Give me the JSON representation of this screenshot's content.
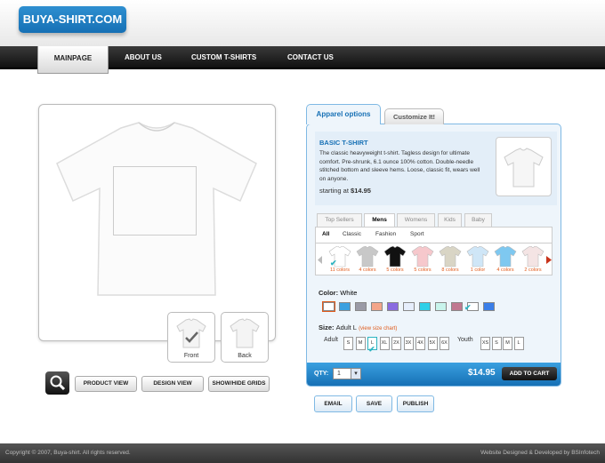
{
  "brand": {
    "logo": "BUYA-SHIRT.COM"
  },
  "nav": {
    "items": [
      "MAINPAGE",
      "ABOUT US",
      "CUSTOM T-SHIRTS",
      "CONTACT US"
    ]
  },
  "preview": {
    "thumbs": [
      "Front",
      "Back"
    ],
    "buttons": [
      "PRODUCT VIEW",
      "DESIGN VIEW",
      "SHOW/HIDE GRIDS"
    ]
  },
  "panel": {
    "tabs": [
      "Apparel options",
      "Customize It!"
    ],
    "product": {
      "title": "BASIC T-SHIRT",
      "description": "The classic heavyweight t-shirt. Tagless design for ultimate comfort. Pre-shrunk, 6.1 ounce 100% cotton. Double-needle stitched bottom and sleeve hems. Loose, classic fit, wears well on anyone.",
      "price_prefix": "starting at",
      "price": "$14.95"
    },
    "categories": [
      "Top Sellers",
      "Mens",
      "Womens",
      "Kids",
      "Baby"
    ],
    "subcategories": [
      "All",
      "Classic",
      "Fashion",
      "Sport"
    ],
    "shirts": [
      {
        "label": "11 colors",
        "color": "#ffffff"
      },
      {
        "label": "4 colors",
        "color": "#c8c8c8"
      },
      {
        "label": "5 colors",
        "color": "#111111"
      },
      {
        "label": "5 colors",
        "color": "#f6c8cc"
      },
      {
        "label": "8 colors",
        "color": "#d9d5c5"
      },
      {
        "label": "1 color",
        "color": "#cfe6f7"
      },
      {
        "label": "4 colors",
        "color": "#7ec8f0"
      },
      {
        "label": "2 colors",
        "color": "#f4e4e4"
      }
    ],
    "color": {
      "label": "Color:",
      "selected": "White",
      "swatches": [
        "#ffffff",
        "#3aa0e0",
        "#9a9aa6",
        "#f3a58a",
        "#8a6be0",
        "#e6eefc",
        "#2ed0e8",
        "#c8f4ec",
        "#c07890",
        "#ffffff",
        "#3a7ee8"
      ]
    },
    "size": {
      "label": "Size:",
      "selected": "Adult L",
      "chart_link": "(view size chart)",
      "adult_label": "Adult",
      "adult": [
        "S",
        "M",
        "L",
        "XL",
        "2X",
        "3X",
        "4X",
        "5X",
        "6X"
      ],
      "youth_label": "Youth",
      "youth": [
        "XS",
        "S",
        "M",
        "L"
      ]
    },
    "qty": {
      "label": "QTY:",
      "value": "1"
    },
    "total": "$14.95",
    "add_to_cart": "ADD TO CART",
    "actions": [
      "EMAIL",
      "SAVE",
      "PUBLISH"
    ]
  },
  "footer": {
    "copyright": "Copyright © 2007, Buya-shirt. All rights reserved.",
    "credit": "Website Designed & Developed by BSInfotech"
  }
}
